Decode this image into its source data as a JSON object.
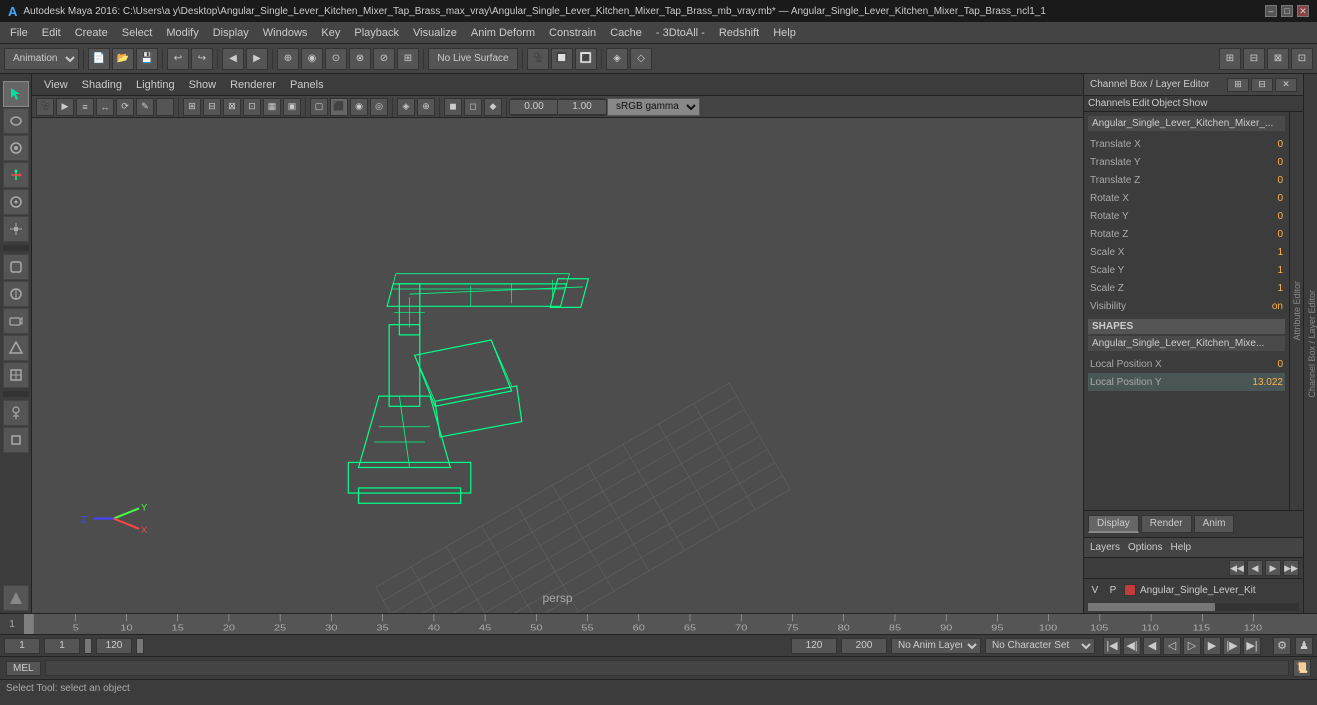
{
  "titlebar": {
    "title": "Autodesk Maya 2016: C:\\Users\\a y\\Desktop\\Angular_Single_Lever_Kitchen_Mixer_Tap_Brass_max_vray\\Angular_Single_Lever_Kitchen_Mixer_Tap_Brass_mb_vray.mb* — Angular_Single_Lever_Kitchen_Mixer_Tap_Brass_ncl1_1",
    "controls": [
      "–",
      "□",
      "✕"
    ]
  },
  "menubar": {
    "items": [
      "File",
      "Edit",
      "Create",
      "Select",
      "Modify",
      "Display",
      "Windows",
      "Key",
      "Playback",
      "Visualize",
      "Anim Deform",
      "Constrain",
      "Cache",
      "- 3DtoAll -",
      "Redshift",
      "Help"
    ]
  },
  "toolbar1": {
    "animation_label": "Animation",
    "no_live_surface": "No Live Surface",
    "srgb_gamma": "sRGB gamma"
  },
  "toolbar2": {
    "icons": [
      "select",
      "lasso",
      "paint",
      "translate",
      "rotate",
      "scale",
      "soft-mod",
      "lattice",
      "sculpt",
      "camera",
      "orbit",
      "zoom",
      "pan",
      "poly-mesh",
      "subdiv",
      "nurbs",
      "component",
      "vertex",
      "edge",
      "face",
      "multi-component"
    ]
  },
  "viewport": {
    "menu_items": [
      "View",
      "Shading",
      "Lighting",
      "Show",
      "Renderer",
      "Panels"
    ],
    "label": "persp",
    "transform_val": "0.00",
    "scale_val": "1.00",
    "gamma": "sRGB gamma"
  },
  "channel_box": {
    "header": "Channel Box / Layer Editor",
    "tabs": {
      "channels": "Channels",
      "edit": "Edit",
      "object": "Object",
      "show": "Show"
    },
    "object_name": "Angular_Single_Lever_Kitchen_Mixer_...",
    "attributes": [
      {
        "name": "Translate X",
        "value": "0"
      },
      {
        "name": "Translate Y",
        "value": "0"
      },
      {
        "name": "Translate Z",
        "value": "0"
      },
      {
        "name": "Rotate X",
        "value": "0"
      },
      {
        "name": "Rotate Y",
        "value": "0"
      },
      {
        "name": "Rotate Z",
        "value": "0"
      },
      {
        "name": "Scale X",
        "value": "1"
      },
      {
        "name": "Scale Y",
        "value": "1"
      },
      {
        "name": "Scale Z",
        "value": "1"
      },
      {
        "name": "Visibility",
        "value": "on"
      }
    ],
    "shapes_header": "SHAPES",
    "shapes_name": "Angular_Single_Lever_Kitchen_Mixe...",
    "shapes_attrs": [
      {
        "name": "Local Position X",
        "value": "0"
      },
      {
        "name": "Local Position Y",
        "value": "13.022"
      }
    ]
  },
  "display_tabs": {
    "display": "Display",
    "render": "Render",
    "anim": "Anim"
  },
  "layer_section": {
    "menus": [
      "Layers",
      "Options",
      "Help"
    ],
    "layer_name": "Angular_Single_Lever_Kit",
    "v": "V",
    "p": "P"
  },
  "timeline": {
    "start": "1",
    "end": "120",
    "ticks": [
      "1",
      "5",
      "10",
      "15",
      "20",
      "25",
      "30",
      "35",
      "40",
      "45",
      "50",
      "55",
      "60",
      "65",
      "70",
      "75",
      "80",
      "85",
      "90",
      "95",
      "100",
      "105",
      "110",
      "115",
      "120"
    ]
  },
  "playback": {
    "current_frame": "1",
    "range_start": "1",
    "range_end": "120",
    "end_frame": "120",
    "max_frame": "200",
    "no_anim_layer": "No Anim Layer",
    "no_char_set": "No Character Set"
  },
  "bottombar": {
    "mel_label": "MEL",
    "command_placeholder": "",
    "status_text": "Select Tool: select an object"
  },
  "axis": {
    "x_color": "#ff4444",
    "y_color": "#44ff44",
    "z_color": "#4444ff"
  }
}
